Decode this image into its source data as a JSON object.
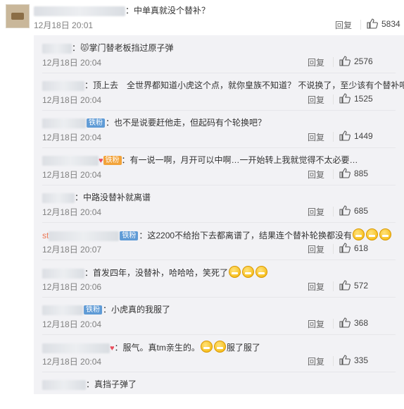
{
  "main_comment": {
    "text": "：中单真就没个替补？",
    "time": "12月18日 20:01",
    "reply_label": "回复",
    "likes": "5834"
  },
  "replies": [
    {
      "prefix": "：",
      "text": "掌门替老板挡过原子弹",
      "time": "12月18日 20:04",
      "reply_label": "回复",
      "likes": "2576"
    },
    {
      "prefix": "：",
      "text": "顶上去　全世界都知道小虎这个点，就你皇族不知道？ 不说换了，至少该有个替补吧",
      "time": "12月18日 20:04",
      "reply_label": "回复",
      "likes": "1525"
    },
    {
      "badge": "铁粉",
      "text": "：也不是说要赶他走，但起码有个轮换吧？",
      "time": "12月18日 20:04",
      "reply_label": "回复",
      "likes": "1449"
    },
    {
      "badge": "铁粉",
      "text": "：有一说一啊，月开可以中啊…一开始转上我就觉得不太必要…",
      "time": "12月18日 20:04",
      "reply_label": "回复",
      "likes": "885"
    },
    {
      "prefix": "：",
      "text": "中路没替补就离谱",
      "time": "12月18日 20:04",
      "reply_label": "回复",
      "likes": "685"
    },
    {
      "name_visible": "st",
      "badge": "铁粉",
      "text": "：这2200不给抬下去都离谱了，结果连个替补轮换都没有",
      "time": "12月18日 20:07",
      "reply_label": "回复",
      "likes": "618"
    },
    {
      "prefix": "：",
      "text": "首发四年，没替补，哈哈哈，笑死了",
      "time": "12月18日 20:06",
      "reply_label": "回复",
      "likes": "572"
    },
    {
      "badge": "铁粉",
      "text": "：小虎真的我服了",
      "time": "12月18日 20:04",
      "reply_label": "回复",
      "likes": "368"
    },
    {
      "text": "：服气。真tm亲生的。",
      "text2": "服了服了",
      "time": "12月18日 20:04",
      "reply_label": "回复",
      "likes": "335"
    },
    {
      "prefix": "：",
      "text": "真挡子弹了",
      "time": "",
      "reply_label": "",
      "likes": ""
    }
  ],
  "icons": {
    "like": "thumbs-up-icon",
    "avatar": "user-avatar",
    "emoji": "laugh-cry-emoji"
  },
  "colors": {
    "sub_background": "#f2f2f5",
    "username": "#eb7350",
    "badge": "#5f9bd6"
  }
}
